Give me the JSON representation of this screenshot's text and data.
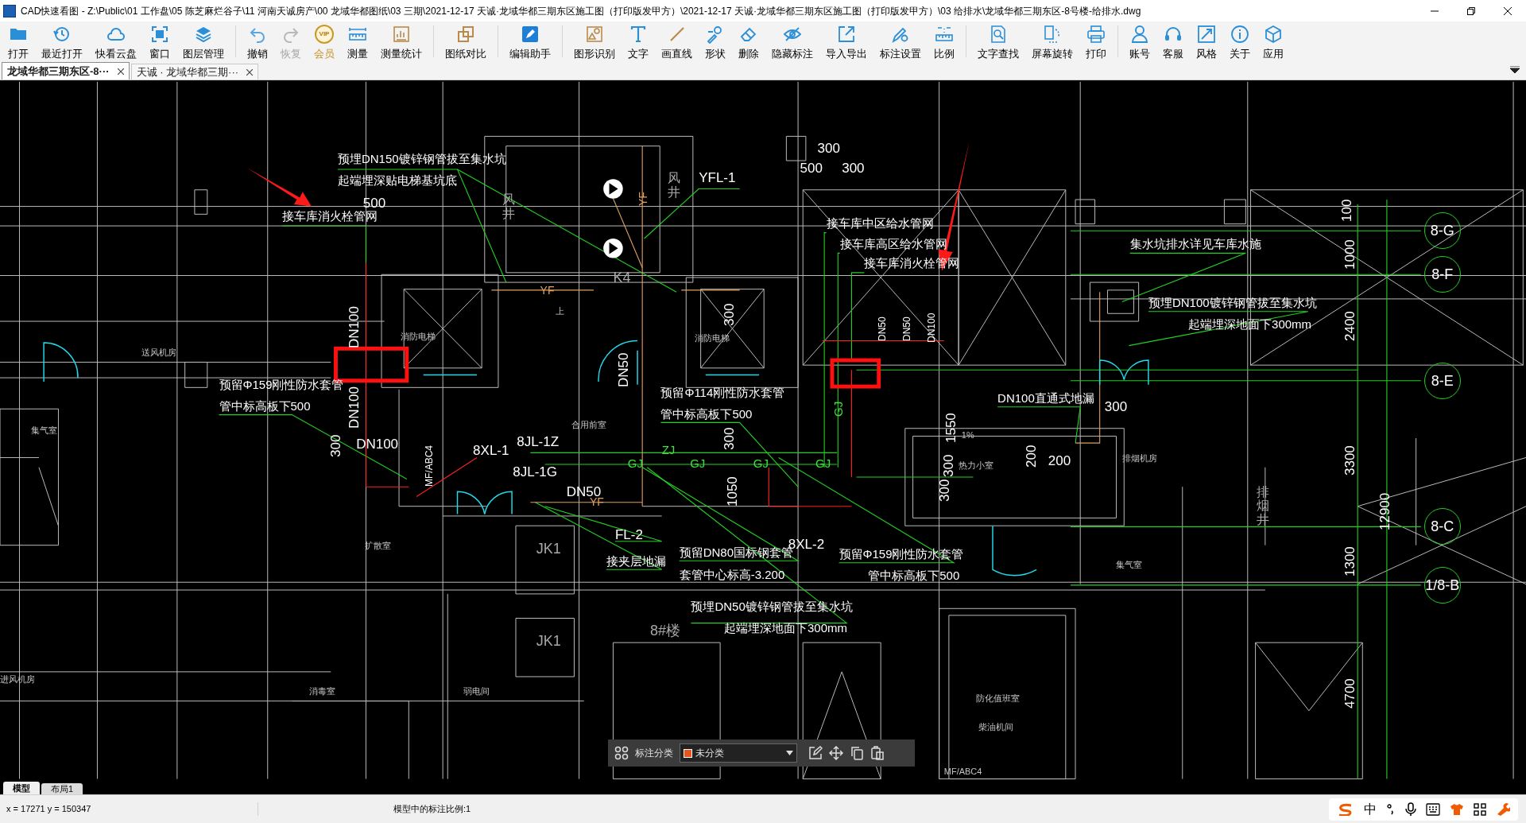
{
  "title_bar": {
    "title": "CAD快速看图 - Z:\\Public\\01 工作盘\\05 陈芝麻烂谷子\\11 河南天诚房产\\00 龙域华都图纸\\03 三期\\2021-12-17 天诚·龙域华都三期东区施工图（打印版发甲方）\\2021-12-17 天诚·龙域华都三期东区施工图（打印版发甲方）\\03 给排水\\龙域华都三期东区-8号楼-给排水.dwg"
  },
  "toolbar": [
    {
      "items": [
        {
          "label": "打开",
          "disabled": false
        },
        {
          "label": "最近打开",
          "disabled": false
        },
        {
          "label": "快看云盘",
          "disabled": false
        },
        {
          "label": "窗口",
          "disabled": false
        },
        {
          "label": "图层管理",
          "disabled": false
        }
      ]
    },
    {
      "items": [
        {
          "label": "撤销",
          "disabled": false
        },
        {
          "label": "恢复",
          "disabled": true
        },
        {
          "label": "会员",
          "disabled": false,
          "badge": "VIP"
        },
        {
          "label": "测量",
          "disabled": false
        },
        {
          "label": "测量统计",
          "disabled": false
        }
      ]
    },
    {
      "items": [
        {
          "label": "图纸对比",
          "disabled": false
        }
      ]
    },
    {
      "items": [
        {
          "label": "编辑助手",
          "disabled": false
        }
      ]
    },
    {
      "items": [
        {
          "label": "图形识别",
          "disabled": false
        },
        {
          "label": "文字",
          "disabled": false
        },
        {
          "label": "画直线",
          "disabled": false
        },
        {
          "label": "形状",
          "disabled": false
        },
        {
          "label": "删除",
          "disabled": false
        },
        {
          "label": "隐藏标注",
          "disabled": false
        },
        {
          "label": "导入导出",
          "disabled": false
        },
        {
          "label": "标注设置",
          "disabled": false
        },
        {
          "label": "比例",
          "disabled": false
        }
      ]
    },
    {
      "items": [
        {
          "label": "文字查找",
          "disabled": false
        },
        {
          "label": "屏幕旋转",
          "disabled": false
        },
        {
          "label": "打印",
          "disabled": false
        }
      ]
    },
    {
      "items": [
        {
          "label": "账号",
          "disabled": false
        },
        {
          "label": "客服",
          "disabled": false
        },
        {
          "label": "风格",
          "disabled": false
        },
        {
          "label": "关于",
          "disabled": false
        },
        {
          "label": "应用",
          "disabled": false
        }
      ]
    }
  ],
  "document_tabs": [
    {
      "label": "龙域华都三期东区-8···",
      "selected": true
    },
    {
      "label": "天诚 · 龙域华都三期···",
      "selected": false
    }
  ],
  "drawing": {
    "labels": [
      {
        "text": "预埋DN150镀锌钢管拔至集水坑",
        "kind": "note"
      },
      {
        "text": "起端埋深贴电梯基坑底",
        "kind": "note"
      },
      {
        "text": "500",
        "kind": "dim"
      },
      {
        "text": "接车库消火栓管网",
        "kind": "note"
      },
      {
        "text": "YFL-1",
        "kind": "dim"
      },
      {
        "text": "300",
        "kind": "dim"
      },
      {
        "text": "500",
        "kind": "dim"
      },
      {
        "text": "300",
        "kind": "dim"
      },
      {
        "text": "接车库中区给水管网",
        "kind": "note"
      },
      {
        "text": "接车库高区给水管网",
        "kind": "note"
      },
      {
        "text": "接车库消火栓管网",
        "kind": "note"
      },
      {
        "text": "集水坑排水详见车库水施",
        "kind": "note"
      },
      {
        "text": "预埋DN100镀锌钢管拔至集水坑",
        "kind": "note"
      },
      {
        "text": "起端埋深地面下300mm",
        "kind": "note"
      },
      {
        "text": "DN100",
        "kind": "vdim"
      },
      {
        "text": "DN100",
        "kind": "vdim"
      },
      {
        "text": "预留Φ159刚性防水套管",
        "kind": "note"
      },
      {
        "text": "管中标高板下500",
        "kind": "note"
      },
      {
        "text": "300",
        "kind": "vdim"
      },
      {
        "text": "DN100",
        "kind": "dim"
      },
      {
        "text": "8XL-1",
        "kind": "dim"
      },
      {
        "text": "8JL-1Z",
        "kind": "dim"
      },
      {
        "text": "8JL-1G",
        "kind": "dim"
      },
      {
        "text": "DN50",
        "kind": "dim"
      },
      {
        "text": "DN50",
        "kind": "vdim"
      },
      {
        "text": "300",
        "kind": "vdim"
      },
      {
        "text": "预留Φ114刚性防水套管",
        "kind": "note"
      },
      {
        "text": "管中标高板下500",
        "kind": "note"
      },
      {
        "text": "300",
        "kind": "vdim"
      },
      {
        "text": "1050",
        "kind": "vdim"
      },
      {
        "text": "FL-2",
        "kind": "dim"
      },
      {
        "text": "接夹层地漏",
        "kind": "note"
      },
      {
        "text": "预留DN80国标钢套管",
        "kind": "note"
      },
      {
        "text": "套管中心标高-3.200",
        "kind": "note"
      },
      {
        "text": "8XL-2",
        "kind": "dim"
      },
      {
        "text": "预留Φ159刚性防水套管",
        "kind": "note"
      },
      {
        "text": "管中标高板下500",
        "kind": "note"
      },
      {
        "text": "预埋DN50镀锌钢管拔至集水坑",
        "kind": "note"
      },
      {
        "text": "起端埋深地面下300mm",
        "kind": "note"
      },
      {
        "text": "DN50",
        "kind": "vsmall"
      },
      {
        "text": "DN50",
        "kind": "vsmall"
      },
      {
        "text": "DN100",
        "kind": "vsmall"
      },
      {
        "text": "DN100直通式地漏",
        "kind": "note"
      },
      {
        "text": "300",
        "kind": "dim"
      },
      {
        "text": "1550",
        "kind": "vdim"
      },
      {
        "text": "300",
        "kind": "vdim"
      },
      {
        "text": "300",
        "kind": "vdim"
      },
      {
        "text": "200",
        "kind": "vdim"
      },
      {
        "text": "200",
        "kind": "dim"
      },
      {
        "text": "1%",
        "kind": "room"
      },
      {
        "text": "100",
        "kind": "vdim"
      },
      {
        "text": "1000",
        "kind": "vdim"
      },
      {
        "text": "2400",
        "kind": "vdim"
      },
      {
        "text": "3300",
        "kind": "vdim"
      },
      {
        "text": "12900",
        "kind": "vdim"
      },
      {
        "text": "1300",
        "kind": "vdim"
      },
      {
        "text": "4700",
        "kind": "vdim"
      },
      {
        "text": "8-G",
        "kind": "axis"
      },
      {
        "text": "8-F",
        "kind": "axis"
      },
      {
        "text": "8-E",
        "kind": "axis"
      },
      {
        "text": "8-C",
        "kind": "axis"
      },
      {
        "text": "1/8-B",
        "kind": "axis"
      },
      {
        "text": "ZJ",
        "kind": "tag"
      },
      {
        "text": "GJ",
        "kind": "tag"
      },
      {
        "text": "GJ",
        "kind": "tag"
      },
      {
        "text": "GJ",
        "kind": "tag"
      },
      {
        "text": "GJ",
        "kind": "tag"
      },
      {
        "text": "GJ",
        "kind": "vtag"
      },
      {
        "text": "YF",
        "kind": "yf"
      },
      {
        "text": "YF",
        "kind": "yf"
      },
      {
        "text": "YF",
        "kind": "vyf"
      },
      {
        "text": "送风机房",
        "kind": "room"
      },
      {
        "text": "集气室",
        "kind": "room"
      },
      {
        "text": "消防电梯",
        "kind": "room"
      },
      {
        "text": "消防电梯",
        "kind": "room"
      },
      {
        "text": "合用前室",
        "kind": "room"
      },
      {
        "text": "上",
        "kind": "room"
      },
      {
        "text": "K4",
        "kind": "mark"
      },
      {
        "text": "扩散室",
        "kind": "room"
      },
      {
        "text": "JK1",
        "kind": "mark"
      },
      {
        "text": "JK1",
        "kind": "mark"
      },
      {
        "text": "进风机房",
        "kind": "room"
      },
      {
        "text": "消毒室",
        "kind": "room"
      },
      {
        "text": "弱电间",
        "kind": "room"
      },
      {
        "text": "8#楼",
        "kind": "mark"
      },
      {
        "text": "热力小室",
        "kind": "room"
      },
      {
        "text": "排烟机房",
        "kind": "room"
      },
      {
        "text": "集气室",
        "kind": "room"
      },
      {
        "text": "防化值班室",
        "kind": "room"
      },
      {
        "text": "柴油机间",
        "kind": "room"
      },
      {
        "text": "MF/ABC4",
        "kind": "room"
      },
      {
        "text": "MF/ABC4",
        "kind": "vsmall"
      },
      {
        "text": "风井",
        "kind": "vroom"
      },
      {
        "text": "风井",
        "kind": "vroom"
      },
      {
        "text": "排烟井",
        "kind": "vroom"
      }
    ]
  },
  "annotation_bar": {
    "label": "标注分类",
    "category": "未分类"
  },
  "layout_tabs": [
    {
      "label": "模型",
      "selected": true
    },
    {
      "label": "布局1",
      "selected": false
    }
  ],
  "status_bar": {
    "coordinates": "x = 17271 y = 150347",
    "scale": "模型中的标注比例:1"
  },
  "ime_tray": {
    "mode": "中"
  }
}
